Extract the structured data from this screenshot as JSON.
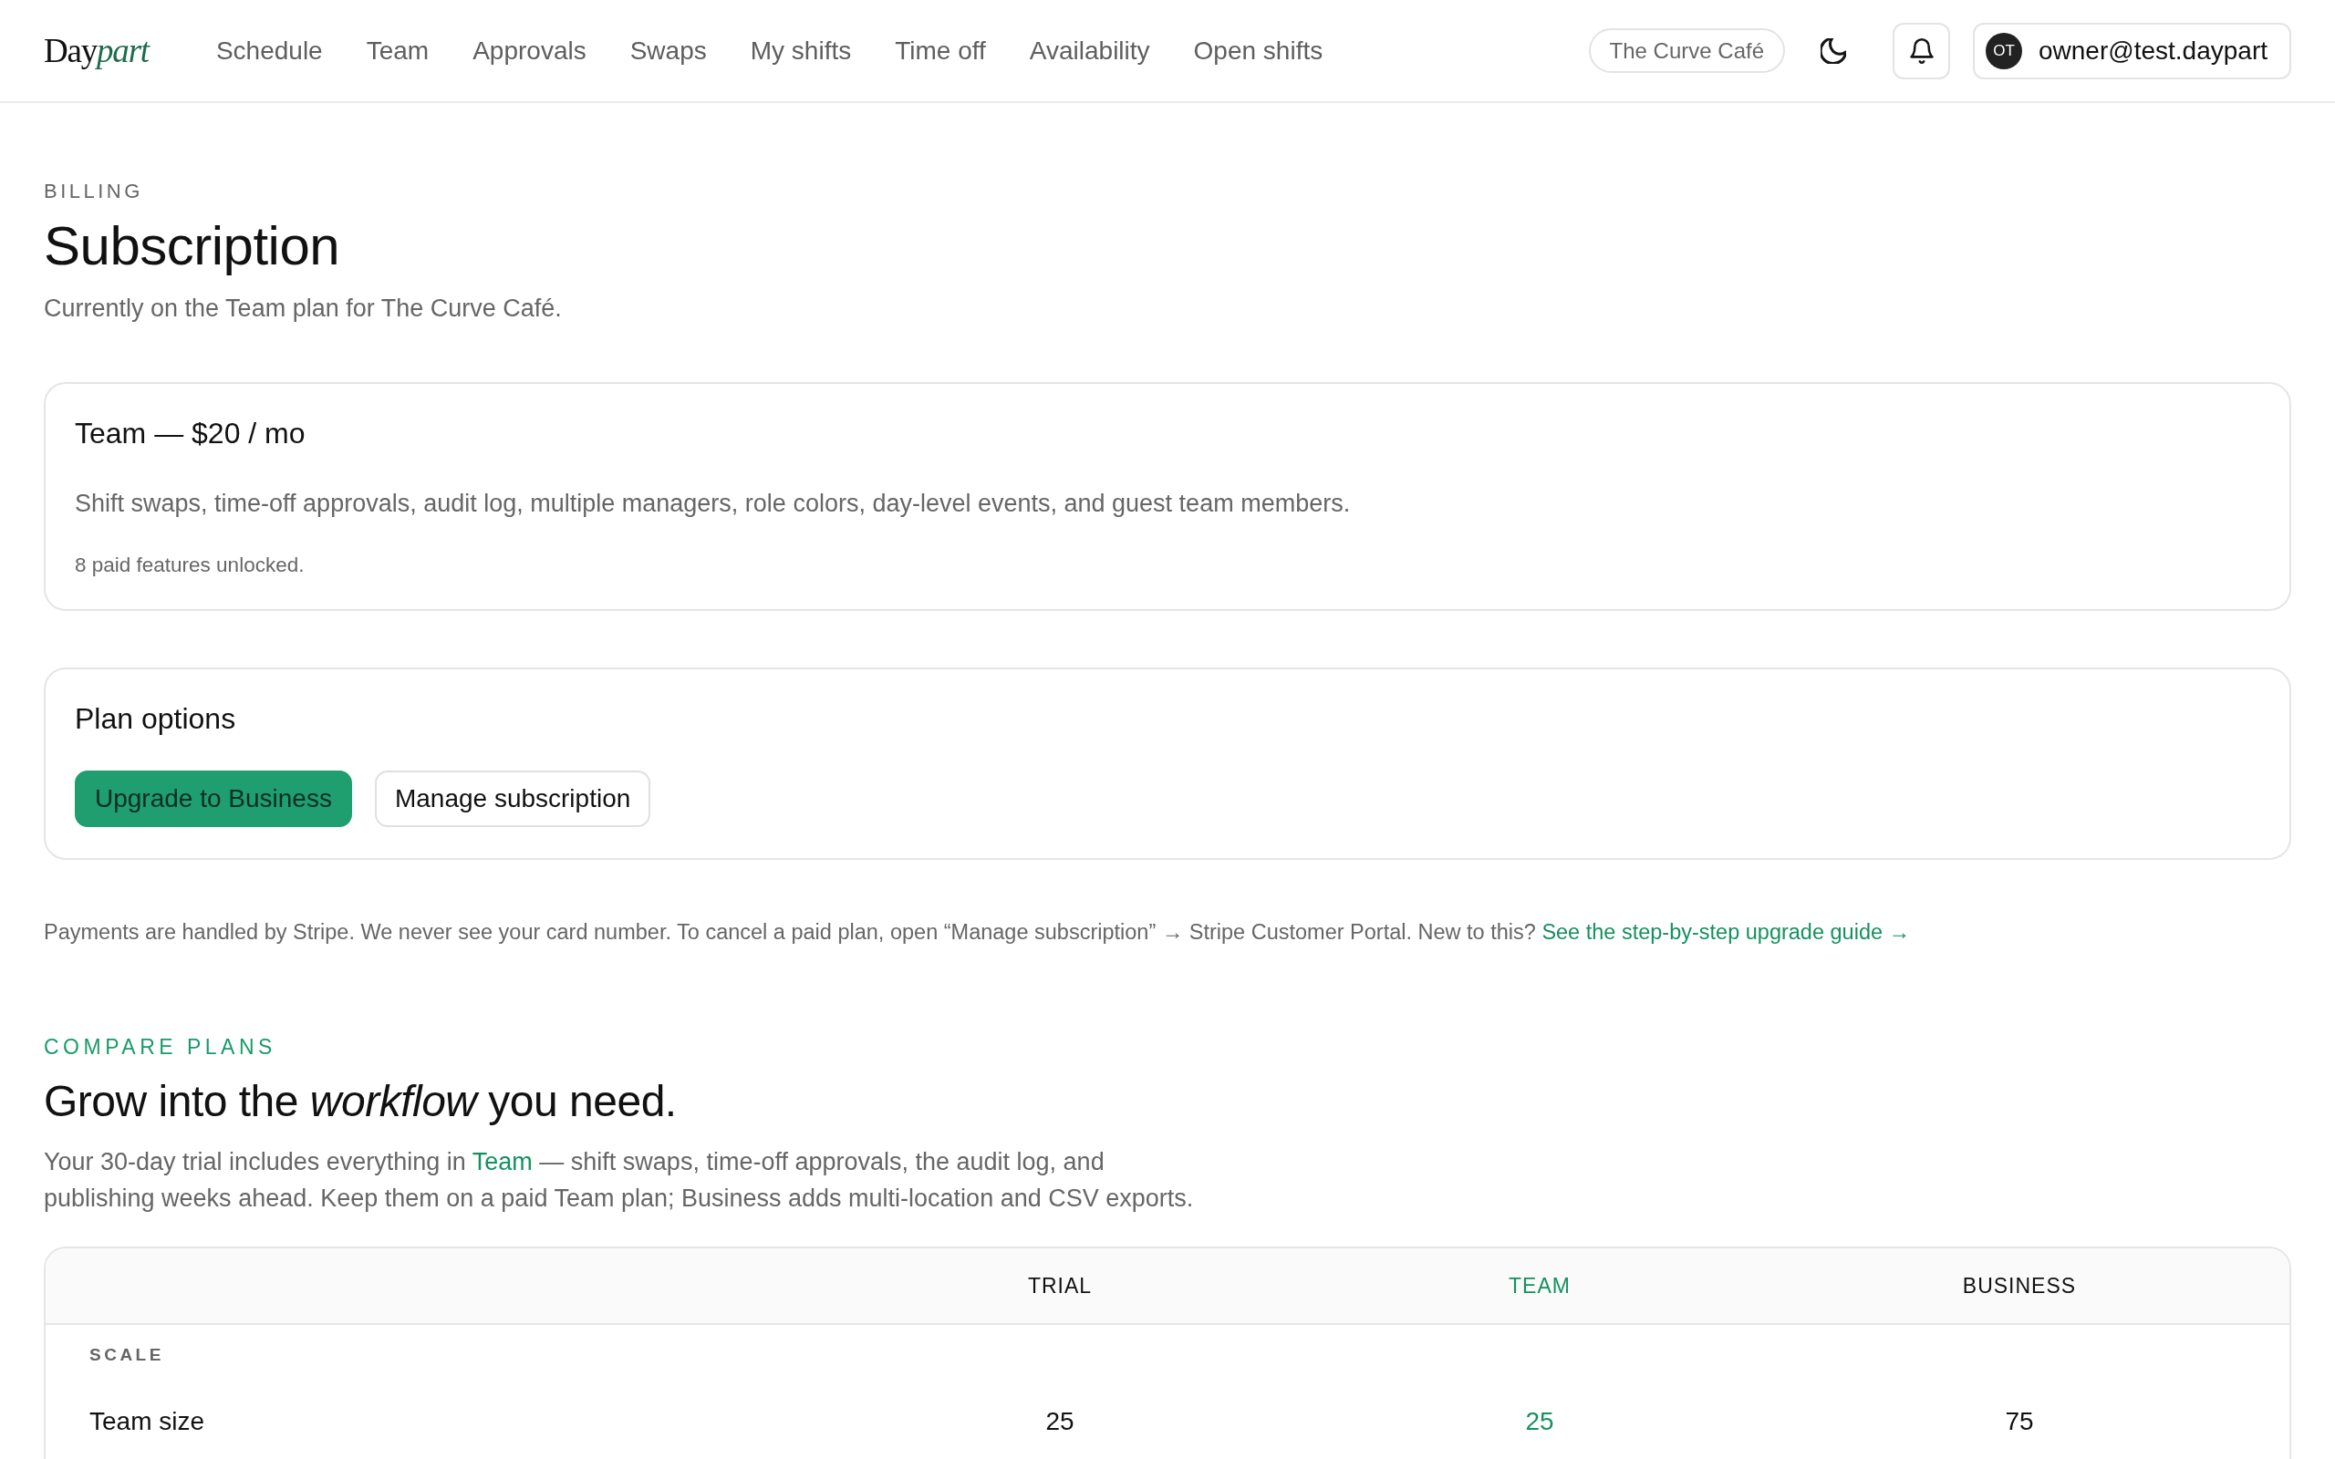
{
  "header": {
    "logo": {
      "main": "Day",
      "accent": "part"
    },
    "nav": [
      {
        "label": "Schedule",
        "selected": false
      },
      {
        "label": "Team",
        "selected": false
      },
      {
        "label": "Approvals",
        "selected": false
      },
      {
        "label": "Swaps",
        "selected": false
      },
      {
        "label": "My shifts",
        "selected": false
      },
      {
        "label": "Time off",
        "selected": false
      },
      {
        "label": "Availability",
        "selected": false
      },
      {
        "label": "Open shifts",
        "selected": false
      }
    ],
    "location": "The Curve Café",
    "account": {
      "initials": "OT",
      "email": "owner@test.daypart"
    }
  },
  "page": {
    "eyebrow": "BILLING",
    "title": "Subscription",
    "subtitle": "Currently on the Team plan for The Curve Café."
  },
  "current_plan": {
    "title": "Team — $20 / mo",
    "description": "Shift swaps, time-off approvals, audit log, multiple managers, role colors, day-level events, and guest team members.",
    "note": "8 paid features unlocked."
  },
  "plan_options": {
    "title": "Plan options",
    "buttons": [
      {
        "label": "Upgrade to Business",
        "kind": "primary"
      },
      {
        "label": "Manage subscription",
        "kind": "secondary"
      }
    ]
  },
  "payment_note": {
    "text": "Payments are handled by Stripe. We never see your card number. To cancel a paid plan, open “Manage subscription” → Stripe Customer Portal. New to this?",
    "link": "See the step-by-step upgrade guide →"
  },
  "compare": {
    "eyebrow": "COMPARE PLANS",
    "heading": "Grow into the *workflow* you need.",
    "intro": [
      {
        "text": "Your 30-day trial includes everything in ",
        "kind": "plain"
      },
      {
        "text": "Team",
        "kind": "accent"
      },
      {
        "text": " — shift swaps, time-off approvals, the audit log, and publishing weeks ahead. Keep them on a paid Team plan; Business adds multi-location and CSV exports.",
        "kind": "plain"
      }
    ],
    "table": {
      "columns": [
        {
          "label": "TRIAL",
          "current": false
        },
        {
          "label": "TEAM",
          "current": true
        },
        {
          "label": "BUSINESS",
          "current": false
        }
      ],
      "sections": [
        {
          "label": "SCALE",
          "rows": [
            {
              "label": "Team size",
              "values": [
                "25",
                "25",
                "75"
              ]
            }
          ]
        }
      ]
    }
  }
}
